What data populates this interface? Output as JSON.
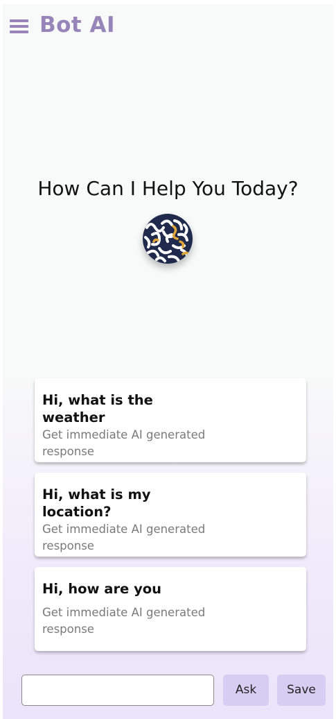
{
  "app": {
    "title": "Bot AI"
  },
  "icons": {
    "menu": "hamburger-menu-icon",
    "logo": "bot-avatar-logo"
  },
  "colors": {
    "brand": "#9785ba",
    "button_bg": "#d7cdf2",
    "logo_bg": "#1f2a4d",
    "logo_accent": "#e0a63a"
  },
  "hero": {
    "title": "How Can I Help You Today?"
  },
  "suggestions": [
    {
      "title": "Hi, what is the weather",
      "subtitle": "Get immediate AI generated response"
    },
    {
      "title": "Hi, what is my location?",
      "subtitle": "Get immediate AI generated response"
    },
    {
      "title": "Hi, how are you",
      "subtitle": "Get immediate AI generated response"
    }
  ],
  "composer": {
    "value": "",
    "placeholder": "",
    "ask_label": "Ask",
    "save_label": "Save"
  }
}
